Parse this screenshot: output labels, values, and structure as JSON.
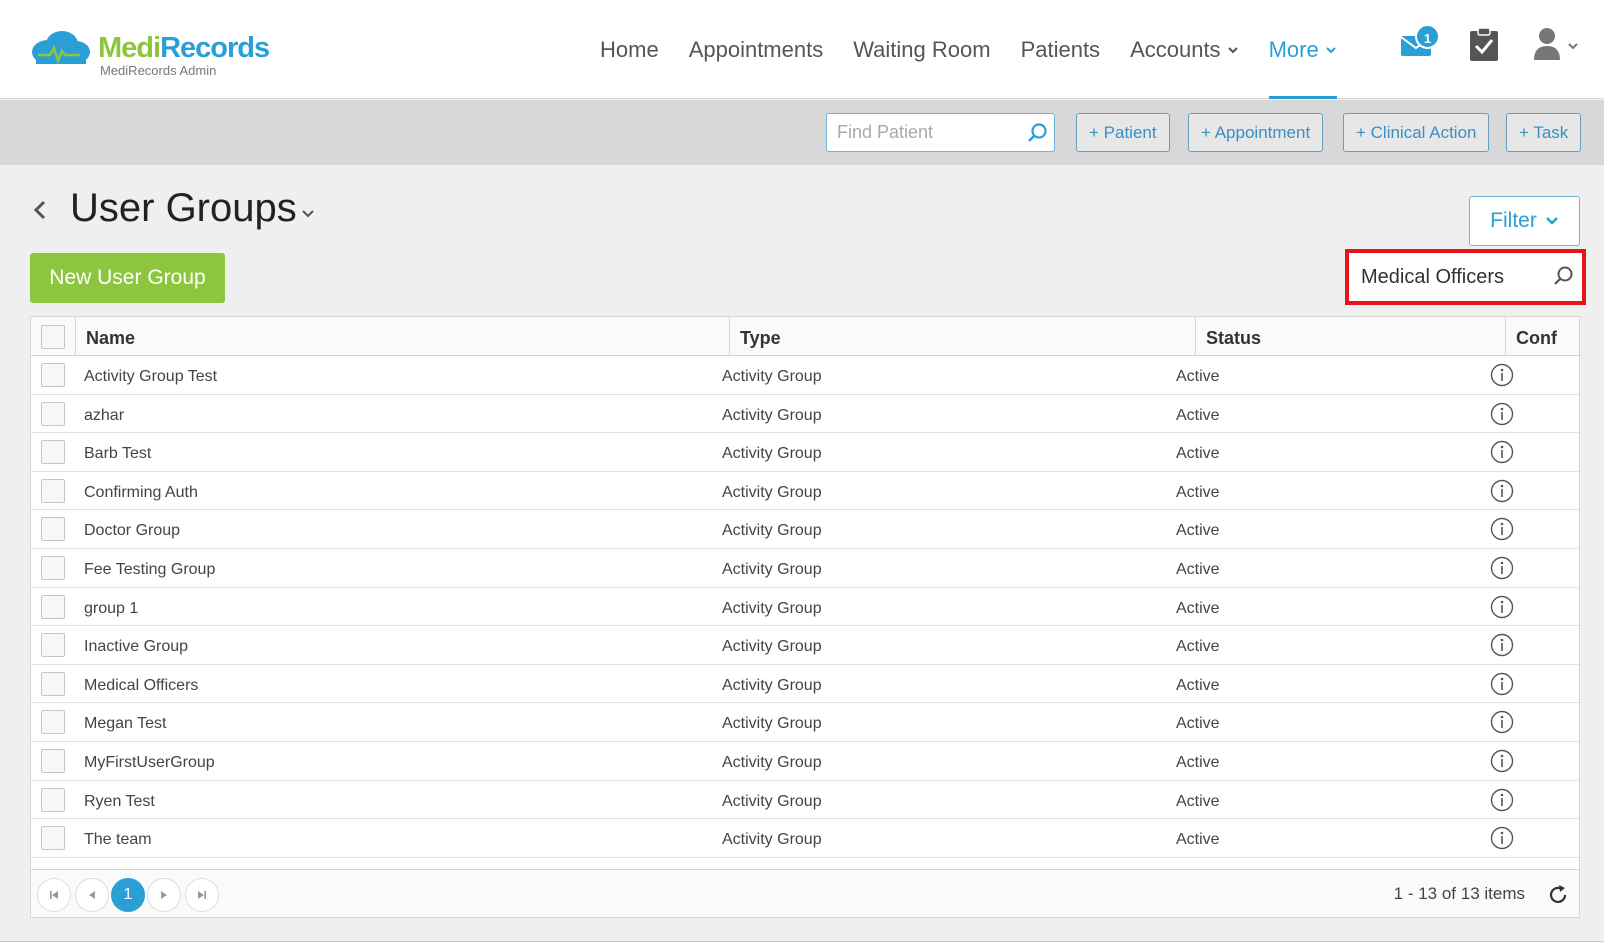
{
  "app": {
    "brand_part1": "Medi",
    "brand_part2": "Records",
    "brand_sub": "MediRecords Admin"
  },
  "nav": {
    "items": [
      {
        "label": "Home"
      },
      {
        "label": "Appointments"
      },
      {
        "label": "Waiting Room"
      },
      {
        "label": "Patients"
      },
      {
        "label": "Accounts",
        "dropdown": true
      },
      {
        "label": "More",
        "dropdown": true,
        "active": true
      }
    ],
    "mail_badge": "1"
  },
  "toolbar": {
    "find_placeholder": "Find Patient",
    "buttons": [
      "+ Patient",
      "+ Appointment",
      "+ Clinical Action",
      "+ Task"
    ]
  },
  "page": {
    "title": "User Groups",
    "filter_label": "Filter",
    "new_button_label": "New User Group",
    "search_value": "Medical Officers"
  },
  "table": {
    "columns": [
      "Name",
      "Type",
      "Status",
      "Conf"
    ],
    "rows": [
      {
        "name": "Activity Group Test",
        "type": "Activity Group",
        "status": "Active"
      },
      {
        "name": "azhar",
        "type": "Activity Group",
        "status": "Active"
      },
      {
        "name": "Barb Test",
        "type": "Activity Group",
        "status": "Active"
      },
      {
        "name": "Confirming Auth",
        "type": "Activity Group",
        "status": "Active"
      },
      {
        "name": "Doctor Group",
        "type": "Activity Group",
        "status": "Active"
      },
      {
        "name": "Fee Testing Group",
        "type": "Activity Group",
        "status": "Active"
      },
      {
        "name": "group 1",
        "type": "Activity Group",
        "status": "Active"
      },
      {
        "name": "Inactive Group",
        "type": "Activity Group",
        "status": "Active"
      },
      {
        "name": "Medical Officers",
        "type": "Activity Group",
        "status": "Active"
      },
      {
        "name": "Megan Test",
        "type": "Activity Group",
        "status": "Active"
      },
      {
        "name": "MyFirstUserGroup",
        "type": "Activity Group",
        "status": "Active"
      },
      {
        "name": "Ryen Test",
        "type": "Activity Group",
        "status": "Active"
      },
      {
        "name": "The team",
        "type": "Activity Group",
        "status": "Active"
      }
    ]
  },
  "pager": {
    "current_page": "1",
    "summary": "1 - 13 of 13 items"
  },
  "colors": {
    "brand_green": "#8cc63f",
    "brand_blue": "#2a9fd6",
    "highlight_red": "#e8141b"
  }
}
